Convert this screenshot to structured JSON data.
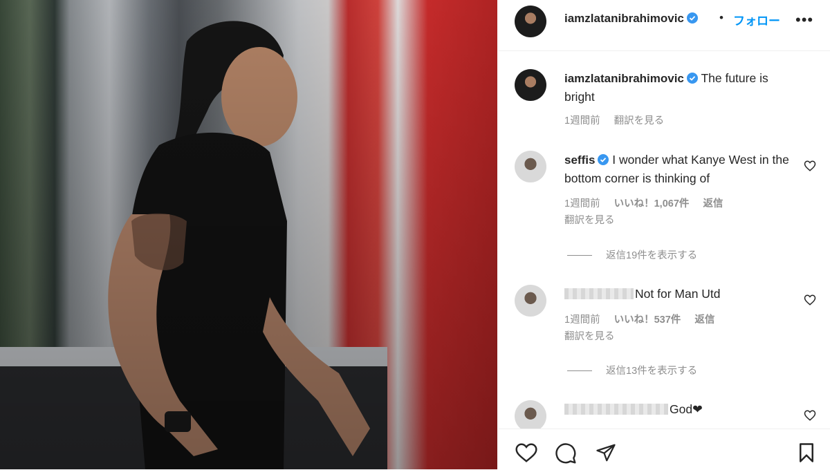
{
  "post": {
    "author": "iamzlatanibrahimovic",
    "dot": "•",
    "follow_label": "フォロー",
    "more_label": "•••",
    "caption_text": "The future is bright",
    "caption_time": "1週間前",
    "caption_translate": "翻訳を見る"
  },
  "comments": [
    {
      "user": "seffis",
      "text": "I wonder what Kanye West in the bottom corner is thinking of",
      "time": "1週間前",
      "likes": "いいね！1,067件",
      "reply": "返信",
      "translate": "翻訳を見る",
      "view_replies": "返信19件を表示する"
    },
    {
      "text": "Not for Man Utd",
      "time": "1週間前",
      "likes": "いいね！537件",
      "reply": "返信",
      "translate": "翻訳を見る",
      "view_replies": "返信13件を表示する"
    },
    {
      "text": "God❤"
    }
  ],
  "icons": {
    "verified": "verified-badge-icon",
    "like": "heart-icon",
    "comment": "comment-icon",
    "share": "send-icon",
    "save": "bookmark-icon"
  },
  "colors": {
    "accent": "#0095f6",
    "muted": "#8e8e8e",
    "text": "#262626"
  }
}
